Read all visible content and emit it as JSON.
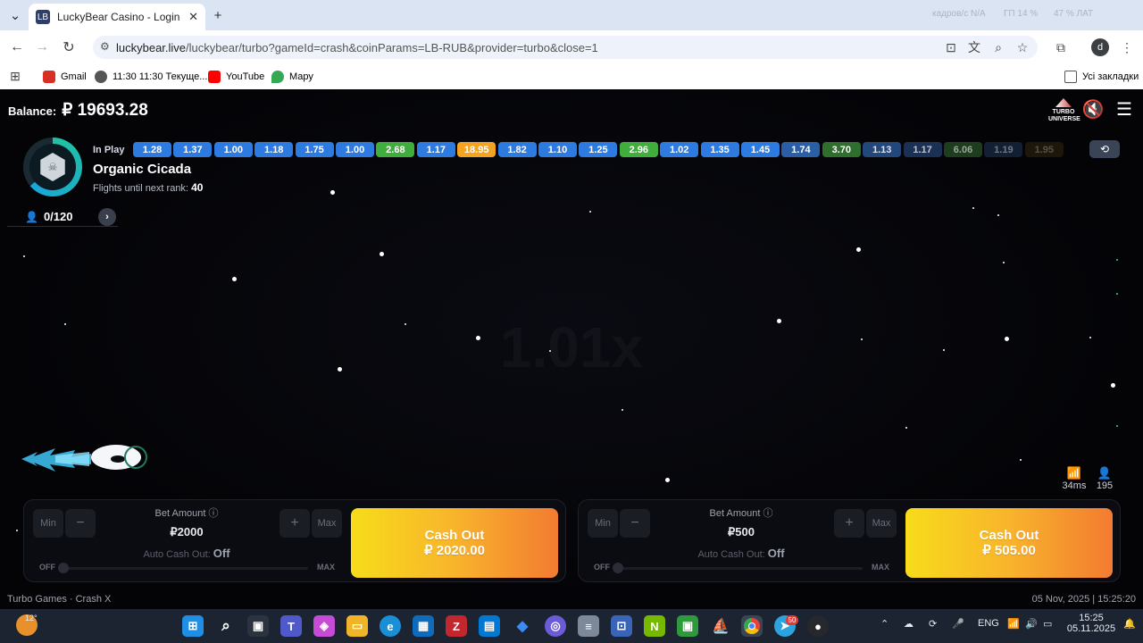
{
  "browser": {
    "tab_title": "LuckyBear Casino - Login and A",
    "tab_favicon": "LB",
    "url_host": "luckybear.live",
    "url_path": "/luckybear/turbo?gameId=crash&coinParams=LB-RUB&provider=turbo&close=1",
    "sys_info_1": "кадров/с N/A",
    "sys_info_2": "ГП 14 %",
    "sys_info_3": "47 % ЛАТ",
    "bookmarks": [
      {
        "label": "Gmail",
        "color": "#d93025"
      },
      {
        "label": "11:30 11:30 Текуще...",
        "color": "#444"
      },
      {
        "label": "YouTube",
        "color": "#ff0000"
      },
      {
        "label": "Мару",
        "color": "#34a853"
      }
    ],
    "all_bookmarks": "Усі закладки",
    "profile_letter": "d"
  },
  "game": {
    "balance_label": "Balance:",
    "balance_value": "₽ 19693.28",
    "turbo_logo": "TURBO UNIVERSE",
    "player": {
      "name": "Organic Cicada",
      "rank_label": "Flights until next rank:",
      "rank_value": "40",
      "players_count": "0/120"
    },
    "in_play_label": "In Play",
    "multipliers": [
      {
        "v": "1.28",
        "c": "#2d7be0"
      },
      {
        "v": "1.37",
        "c": "#2d7be0"
      },
      {
        "v": "1.00",
        "c": "#2d7be0"
      },
      {
        "v": "1.18",
        "c": "#2d7be0"
      },
      {
        "v": "1.75",
        "c": "#2d7be0"
      },
      {
        "v": "1.00",
        "c": "#2d7be0"
      },
      {
        "v": "2.68",
        "c": "#3fae3c"
      },
      {
        "v": "1.17",
        "c": "#2d7be0"
      },
      {
        "v": "18.95",
        "c": "#f3a321"
      },
      {
        "v": "1.82",
        "c": "#2d7be0"
      },
      {
        "v": "1.10",
        "c": "#2d7be0"
      },
      {
        "v": "1.25",
        "c": "#2d7be0"
      },
      {
        "v": "2.96",
        "c": "#3fae3c"
      },
      {
        "v": "1.02",
        "c": "#2d7be0"
      },
      {
        "v": "1.35",
        "c": "#2d7be0"
      },
      {
        "v": "1.45",
        "c": "#2d7be0"
      },
      {
        "v": "1.74",
        "c": "#2a5fa6"
      },
      {
        "v": "3.70",
        "c": "#2f6e2d"
      },
      {
        "v": "1.13",
        "c": "#22477b"
      },
      {
        "v": "1.17",
        "c": "#1a3155"
      },
      {
        "v": "6.06",
        "c": "#1e3c1e"
      },
      {
        "v": "1.19",
        "c": "#131f33"
      },
      {
        "v": "1.95",
        "c": "#1d160a"
      }
    ],
    "center_multiplier": "1.01x",
    "ping": "34ms",
    "online": "195",
    "panels": [
      {
        "min": "Min",
        "minus": "−",
        "plus": "+",
        "max": "Max",
        "bet_label": "Bet Amount",
        "bet_value": "₽2000",
        "auto_label": "Auto Cash Out:",
        "auto_value": "Off",
        "slider_off": "OFF",
        "slider_max": "MAX",
        "cashout_label": "Cash Out",
        "cashout_value": "₽ 2020.00"
      },
      {
        "min": "Min",
        "minus": "−",
        "plus": "+",
        "max": "Max",
        "bet_label": "Bet Amount",
        "bet_value": "₽500",
        "auto_label": "Auto Cash Out:",
        "auto_value": "Off",
        "slider_off": "OFF",
        "slider_max": "MAX",
        "cashout_label": "Cash Out",
        "cashout_value": "₽ 505.00"
      }
    ],
    "footer_left": "Turbo Games · Crash X",
    "footer_right": "05 Nov, 2025 | 15:25:20"
  },
  "taskbar": {
    "weather": "12°",
    "lang": "ENG",
    "time": "15:25",
    "date": "05.11.2025",
    "telegram_badge": "50"
  }
}
